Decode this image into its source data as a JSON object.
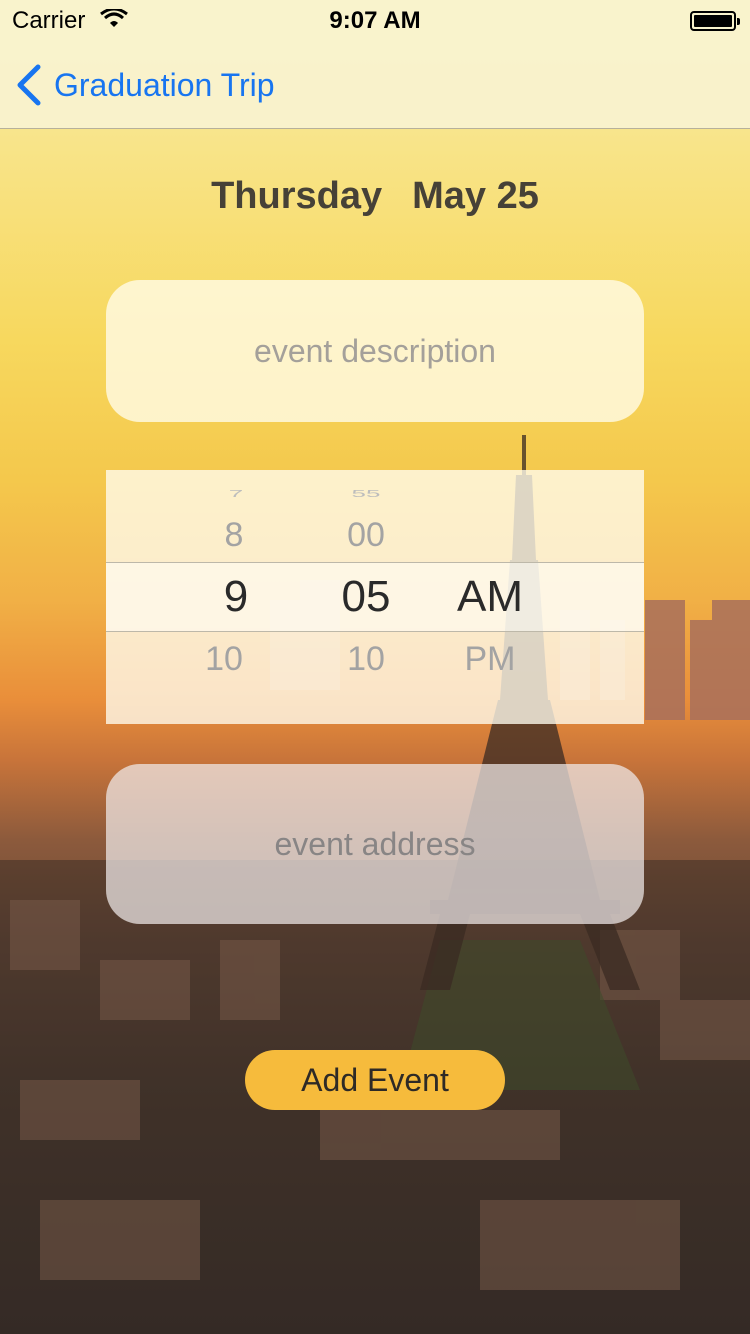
{
  "status_bar": {
    "carrier": "Carrier",
    "time": "9:07 AM"
  },
  "nav": {
    "back_label": "Graduation Trip",
    "accent_color": "#1875f0"
  },
  "date": {
    "weekday": "Thursday",
    "month_day": "May 25"
  },
  "description_field": {
    "placeholder": "event description"
  },
  "time_picker": {
    "hours": {
      "above": "8",
      "selected": "9",
      "below": "10"
    },
    "minutes": {
      "above": "00",
      "selected": "05",
      "below": "10"
    },
    "period": {
      "selected": "AM",
      "below": "PM"
    }
  },
  "address_field": {
    "placeholder": "event address"
  },
  "add_button": {
    "label": "Add Event",
    "color": "#f6bb3c"
  },
  "background": {
    "description_icon": "eiffel-tower-cityscape-image"
  }
}
